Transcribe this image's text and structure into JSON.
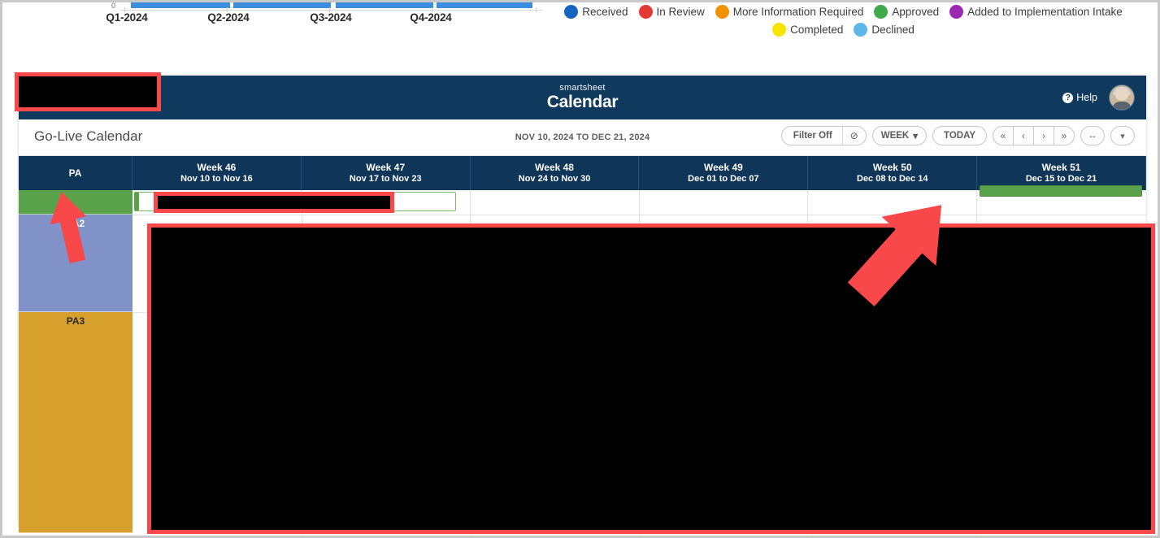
{
  "chart_data": {
    "type": "bar",
    "title": "",
    "xlabel": "",
    "ylabel": "",
    "categories": [
      "Q1-2024",
      "Q2-2024",
      "Q3-2024",
      "Q4-2024"
    ],
    "values": [
      1,
      1,
      1,
      1
    ],
    "ytick_visible": "0",
    "ylim": [
      0,
      1
    ],
    "grid": false,
    "series_color": "#3a8edd",
    "note": "Only the bottom of the bar chart is visible; bars are cropped at the top of the screenshot."
  },
  "legend": {
    "row1": [
      {
        "label": "Received",
        "color": "#1565c0"
      },
      {
        "label": "In Review",
        "color": "#e53935"
      },
      {
        "label": "More Information Required",
        "color": "#f39200"
      },
      {
        "label": "Approved",
        "color": "#3faa4c"
      },
      {
        "label": "Added to Implementation Intake",
        "color": "#9c27b0"
      }
    ],
    "row2": [
      {
        "label": "Completed",
        "color": "#f5e500"
      },
      {
        "label": "Declined",
        "color": "#5bb8e8"
      }
    ]
  },
  "appbar": {
    "brand": "smartsheet",
    "product": "Calendar",
    "help_label": "Help",
    "help_icon": "?",
    "avatar_name": "user-avatar"
  },
  "titlebar": {
    "calendar_title": "Go-Live Calendar",
    "date_range": "NOV 10, 2024 TO DEC 21, 2024"
  },
  "toolbar": {
    "filter_label": "Filter Off",
    "filter_icon": "⊘",
    "view_label": "WEEK",
    "view_caret": "▾",
    "today_label": "TODAY",
    "nav": [
      {
        "name": "first",
        "glyph": "«"
      },
      {
        "name": "previous",
        "glyph": "‹"
      },
      {
        "name": "next",
        "glyph": "›"
      },
      {
        "name": "last",
        "glyph": "»"
      }
    ],
    "resize_glyph": "↔",
    "more_glyph": "▾"
  },
  "calendar": {
    "row_header_label": "PA",
    "columns": [
      {
        "week": "Week 46",
        "dates": "Nov 10 to Nov 16"
      },
      {
        "week": "Week 47",
        "dates": "Nov 17 to Nov 23"
      },
      {
        "week": "Week 48",
        "dates": "Nov 24 to Nov 30"
      },
      {
        "week": "Week 49",
        "dates": "Dec 01 to Dec 07"
      },
      {
        "week": "Week 50",
        "dates": "Dec 08 to Dec 14"
      },
      {
        "week": "Week 51",
        "dates": "Dec 15 to Dec 21"
      }
    ],
    "rows": [
      {
        "label": "",
        "color": "#5aa14c"
      },
      {
        "label": "PA2",
        "color": "#8092c8"
      },
      {
        "label": "PA3",
        "color": "#d79f2c"
      }
    ],
    "events": [
      {
        "name": "event-week46-47",
        "label": "",
        "style": "green-outline"
      },
      {
        "name": "event-week51",
        "label": "",
        "style": "green-solid"
      }
    ]
  },
  "annotations": {
    "redactions": [
      {
        "name": "redaction-header"
      },
      {
        "name": "redaction-event"
      },
      {
        "name": "redaction-main"
      }
    ],
    "arrows": [
      {
        "name": "arrow-left",
        "direction": "up"
      },
      {
        "name": "arrow-right",
        "direction": "up-right"
      }
    ],
    "color": "#f8484a"
  }
}
